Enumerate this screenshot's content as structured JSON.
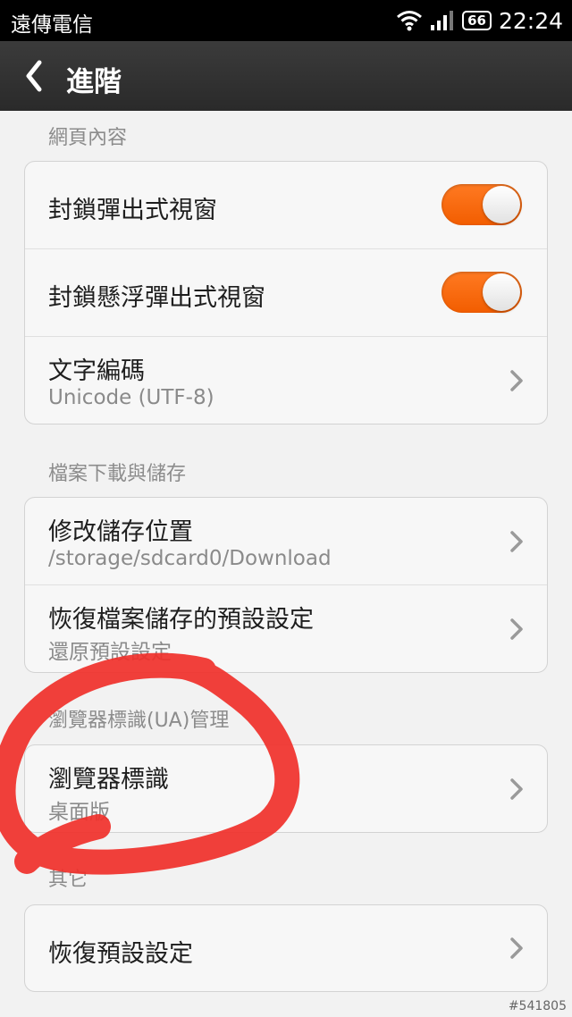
{
  "status_bar": {
    "carrier": "遠傳電信",
    "battery": "66",
    "time": "22:24"
  },
  "action_bar": {
    "title": "進階"
  },
  "sections": {
    "web_content": {
      "header": "網頁內容",
      "block_popups": {
        "label": "封鎖彈出式視窗",
        "enabled": true
      },
      "block_floating_popups": {
        "label": "封鎖懸浮彈出式視窗",
        "enabled": true
      },
      "text_encoding": {
        "label": "文字編碼",
        "value": "Unicode (UTF-8)"
      }
    },
    "downloads": {
      "header": "檔案下載與儲存",
      "storage_location": {
        "label": "修改儲存位置",
        "value": "/storage/sdcard0/Download"
      },
      "restore_storage_defaults": {
        "label": "恢復檔案儲存的預設設定",
        "value": "還原預設設定"
      }
    },
    "user_agent": {
      "header": "瀏覽器標識(UA)管理",
      "browser_identity": {
        "label": "瀏覽器標識",
        "value": "桌面版"
      }
    },
    "other": {
      "header": "其它",
      "restore_defaults": {
        "label": "恢復預設設定"
      }
    }
  },
  "annotation": {
    "color": "#f0302a"
  },
  "colors": {
    "toggle_on": "#f46a10",
    "action_bar": "#333333"
  },
  "watermark": "#541805"
}
